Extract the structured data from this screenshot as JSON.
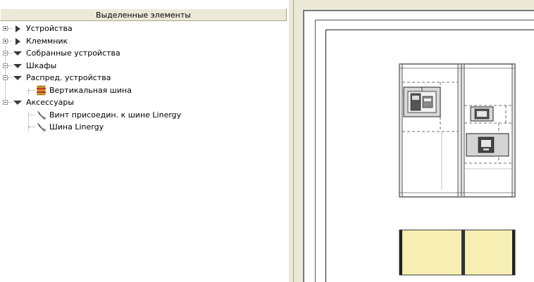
{
  "tree_panel": {
    "header": "Выделенные элементы",
    "items": [
      {
        "label": "Устройства"
      },
      {
        "label": "Клеммник"
      },
      {
        "label": "Собранные устройства"
      },
      {
        "label": "Шкафы"
      },
      {
        "label": "Распред. устройства"
      },
      {
        "label": "Вертикальная шина"
      },
      {
        "label": "Аксессуары"
      },
      {
        "label": "Винт присоедин. к шине Linergy"
      },
      {
        "label": "Шина Linergy"
      }
    ]
  },
  "colors": {
    "panel_background": "#ece9d8",
    "busbar_fill": "#f7efb4",
    "tree_text": "#000000"
  },
  "icons": [
    "expand-plus-icon",
    "collapse-minus-icon",
    "node-collapsed-icon",
    "node-expanded-icon",
    "vertical-busbar-icon",
    "wrench-accessory-icon"
  ]
}
